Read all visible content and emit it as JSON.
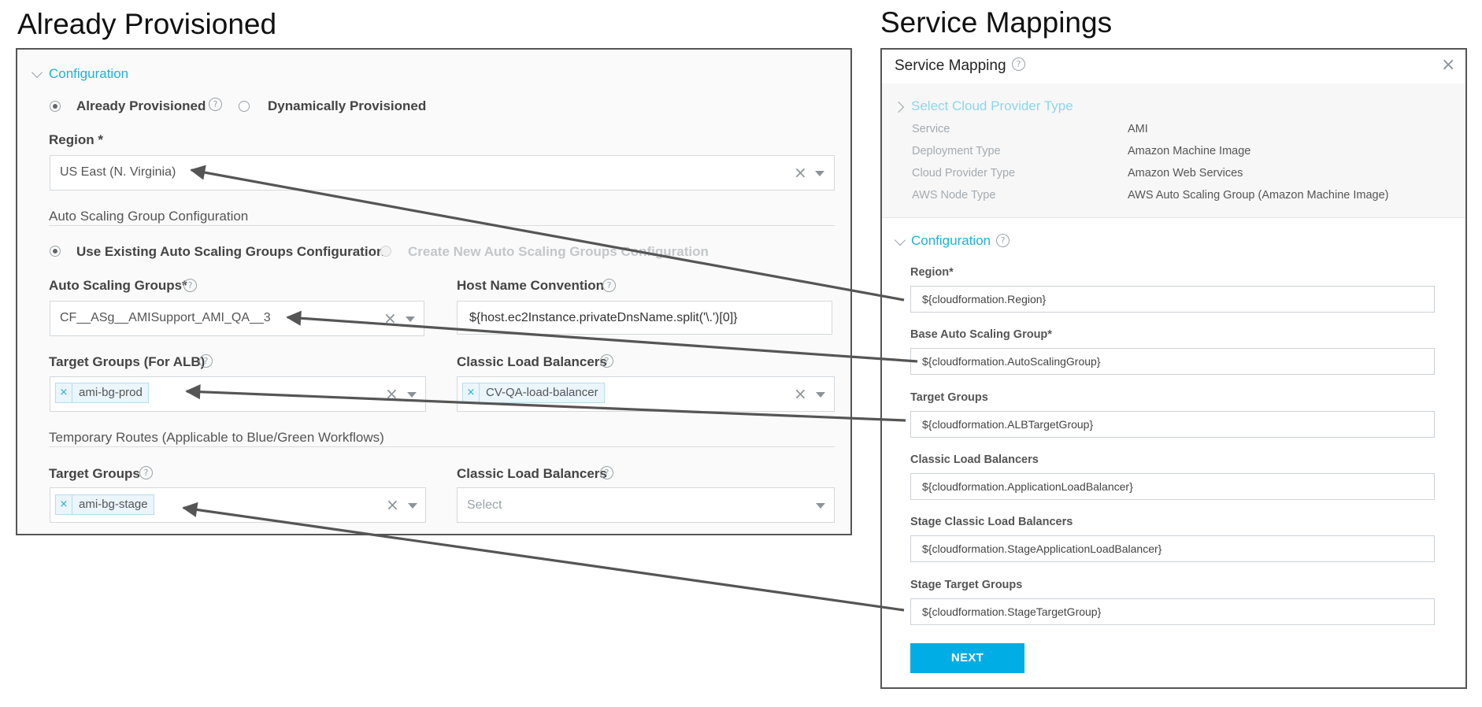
{
  "headings": {
    "left": "Already Provisioned",
    "right": "Service Mappings"
  },
  "left_panel": {
    "section_title": "Configuration",
    "provision_options": [
      {
        "label": "Already Provisioned",
        "selected": true
      },
      {
        "label": "Dynamically Provisioned",
        "selected": false
      }
    ],
    "region": {
      "label": "Region *",
      "value": "US East (N. Virginia)"
    },
    "asg_config": {
      "title": "Auto Scaling Group Configuration",
      "options": [
        {
          "label": "Use Existing Auto Scaling Groups Configuration",
          "selected": true
        },
        {
          "label": "Create New Auto Scaling Groups Configuration",
          "selected": false,
          "disabled": true
        }
      ]
    },
    "auto_scaling_groups": {
      "label": "Auto Scaling Groups*",
      "value": "CF__ASg__AMISupport_AMI_QA__3"
    },
    "host_name_convention": {
      "label": "Host Name Convention",
      "value": "${host.ec2Instance.privateDnsName.split('\\.')[0]}"
    },
    "target_groups_alb": {
      "label": "Target Groups (For ALB)",
      "tags": [
        "ami-bg-prod"
      ]
    },
    "classic_load_balancers": {
      "label": "Classic Load Balancers",
      "tags": [
        "CV-QA-load-balancer"
      ]
    },
    "temp_routes": {
      "title": "Temporary Routes (Applicable to Blue/Green Workflows)",
      "target_groups": {
        "label": "Target Groups",
        "tags": [
          "ami-bg-stage"
        ]
      },
      "classic_load_balancers": {
        "label": "Classic Load Balancers",
        "placeholder": "Select"
      }
    }
  },
  "service_mapping": {
    "title": "Service Mapping",
    "cloud_provider_section": "Select Cloud Provider Type",
    "summary": [
      {
        "key": "Service",
        "value": "AMI"
      },
      {
        "key": "Deployment Type",
        "value": "Amazon Machine Image"
      },
      {
        "key": "Cloud Provider Type",
        "value": "Amazon Web Services"
      },
      {
        "key": "AWS Node Type",
        "value": "AWS Auto Scaling Group (Amazon Machine Image)"
      }
    ],
    "config_section": "Configuration",
    "fields": [
      {
        "label": "Region*",
        "value": "${cloudformation.Region}"
      },
      {
        "label": "Base Auto Scaling Group*",
        "value": "${cloudformation.AutoScalingGroup}"
      },
      {
        "label": "Target Groups",
        "value": "${cloudformation.ALBTargetGroup}"
      },
      {
        "label": "Classic Load Balancers",
        "value": "${cloudformation.ApplicationLoadBalancer}"
      },
      {
        "label": "Stage Classic Load Balancers",
        "value": "${cloudformation.StageApplicationLoadBalancer}"
      },
      {
        "label": "Stage Target Groups",
        "value": "${cloudformation.StageTargetGroup}"
      }
    ],
    "next_label": "NEXT"
  },
  "colors": {
    "accent": "#1eb2d8",
    "button": "#00ade4",
    "arrow": "#555555"
  },
  "icons": {
    "help": "question-circle-icon",
    "clear": "clear-x-icon",
    "caret": "caret-down-icon",
    "close": "close-icon"
  }
}
